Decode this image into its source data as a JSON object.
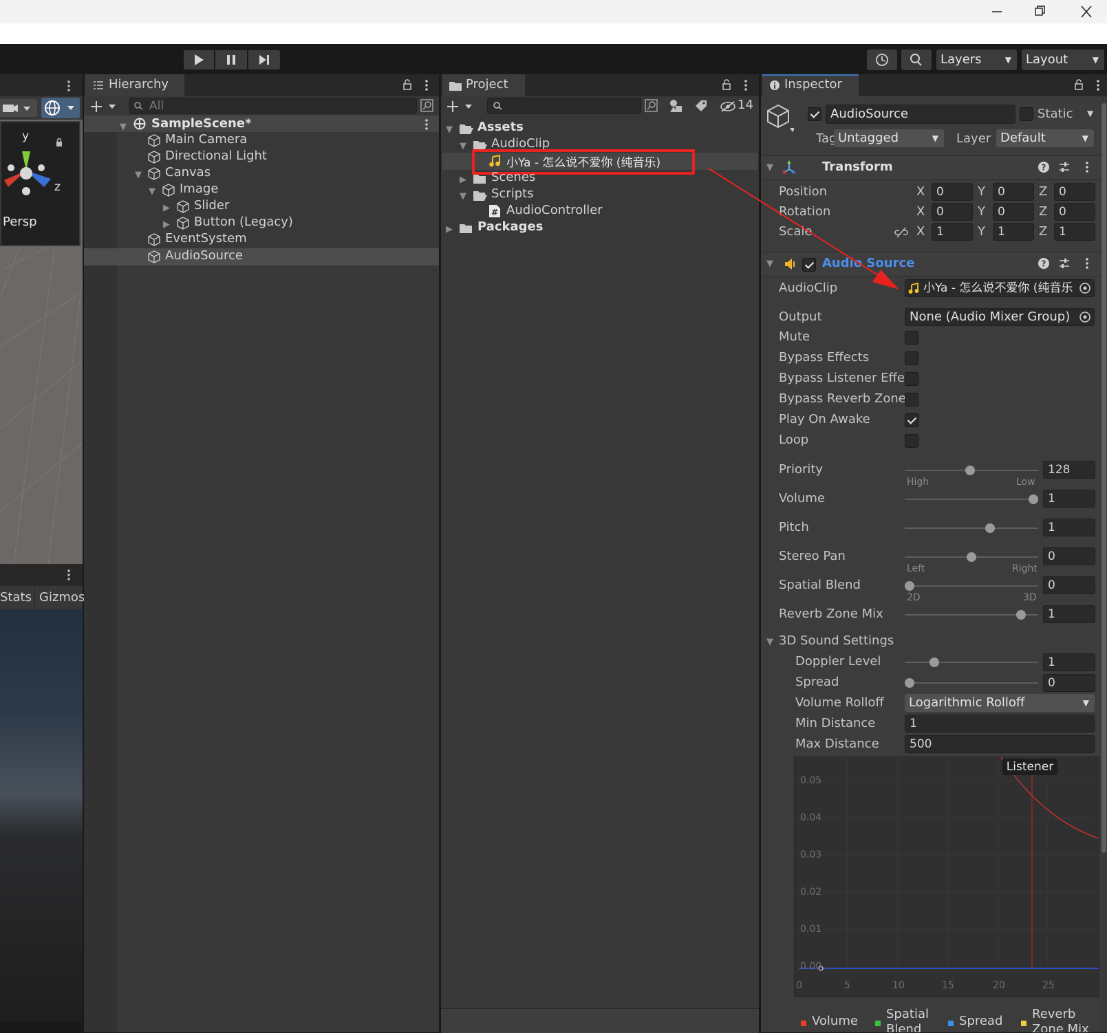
{
  "window": {
    "controls": {
      "minimize": "minimize",
      "maximize": "maximize",
      "close": "close"
    }
  },
  "toolbar": {
    "layers_label": "Layers",
    "layout_label": "Layout"
  },
  "scene_view": {
    "axis_y": "y",
    "axis_z": "z",
    "persp_label": "Persp",
    "stats_tab": "Stats",
    "gizmos_tab": "Gizmos"
  },
  "hierarchy": {
    "tab": "Hierarchy",
    "search_placeholder": "All",
    "scene": "SampleScene*",
    "items": [
      "Main Camera",
      "Directional Light",
      "Canvas",
      "Image",
      "Slider",
      "Button (Legacy)",
      "EventSystem",
      "AudioSource"
    ]
  },
  "project": {
    "tab": "Project",
    "hidden_count": "14",
    "tree": {
      "assets": "Assets",
      "audioclip_folder": "AudioClip",
      "clip_file": "小Ya - 怎么说不爱你 (纯音乐)",
      "scenes": "Scenes",
      "scripts": "Scripts",
      "audio_controller": "AudioController",
      "packages": "Packages"
    }
  },
  "inspector": {
    "tab": "Inspector",
    "object_name": "AudioSource",
    "static_label": "Static",
    "tag_label": "Tag",
    "tag_value": "Untagged",
    "layer_label": "Layer",
    "layer_value": "Default",
    "transform": {
      "title": "Transform",
      "position_label": "Position",
      "rotation_label": "Rotation",
      "scale_label": "Scale",
      "x": "X",
      "y": "Y",
      "z": "Z",
      "position": [
        "0",
        "0",
        "0"
      ],
      "rotation": [
        "0",
        "0",
        "0"
      ],
      "scale": [
        "1",
        "1",
        "1"
      ]
    },
    "audio_source": {
      "title": "Audio Source",
      "audioclip_label": "AudioClip",
      "audioclip_value": "小Ya - 怎么说不爱你 (纯音乐",
      "output_label": "Output",
      "output_value": "None (Audio Mixer Group)",
      "mute": "Mute",
      "bypass_effects": "Bypass Effects",
      "bypass_listener": "Bypass Listener Effe",
      "bypass_reverb": "Bypass Reverb Zone",
      "play_on_awake": "Play On Awake",
      "loop": "Loop",
      "priority_label": "Priority",
      "priority_value": "128",
      "priority_fraction": 0.49,
      "priority_left": "High",
      "priority_right": "Low",
      "volume_label": "Volume",
      "volume_value": "1",
      "volume_fraction": 1.0,
      "pitch_label": "Pitch",
      "pitch_value": "1",
      "pitch_fraction": 0.65,
      "stereo_label": "Stereo Pan",
      "stereo_value": "0",
      "stereo_fraction": 0.5,
      "stereo_left": "Left",
      "stereo_right": "Right",
      "spatial_label": "Spatial Blend",
      "spatial_value": "0",
      "spatial_fraction": 0.0,
      "spatial_left": "2D",
      "spatial_right": "3D",
      "reverb_mix_label": "Reverb Zone Mix",
      "reverb_mix_value": "1",
      "reverb_mix_fraction": 0.9,
      "sound3d_title": "3D Sound Settings",
      "doppler_label": "Doppler Level",
      "doppler_value": "1",
      "doppler_fraction": 0.2,
      "spread_label": "Spread",
      "spread_value": "0",
      "spread_fraction": 0.0,
      "rolloff_label": "Volume Rolloff",
      "rolloff_value": "Logarithmic Rolloff",
      "min_distance_label": "Min Distance",
      "min_distance_value": "1",
      "max_distance_label": "Max Distance",
      "max_distance_value": "500"
    },
    "graph": {
      "listener_label": "Listener",
      "y_ticks": [
        "0.05",
        "0.04",
        "0.03",
        "0.02",
        "0.01",
        "0.00"
      ],
      "x_ticks": [
        "0",
        "5",
        "10",
        "15",
        "20",
        "25"
      ],
      "legend": [
        "Volume",
        "Spatial Blend",
        "Spread",
        "Reverb Zone Mix"
      ]
    }
  },
  "colors": {
    "highlight_box": "#e8231f",
    "arrow": "#e8231f",
    "link_blue": "#4c8fe9",
    "panel_bg": "#383838",
    "input_bg": "#2a2a2a"
  }
}
